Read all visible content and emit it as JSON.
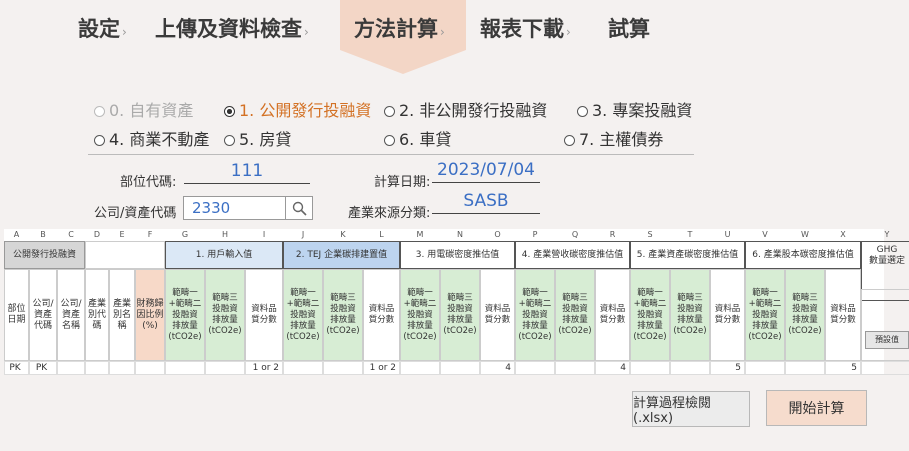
{
  "tabs": [
    {
      "label": "設定"
    },
    {
      "label": "上傳及資料檢查"
    },
    {
      "label": "方法計算"
    },
    {
      "label": "報表下載"
    },
    {
      "label": "試算"
    }
  ],
  "asset_types": [
    {
      "label": "0. 自有資產",
      "state": "disabled"
    },
    {
      "label": "1. 公開發行投融資",
      "state": "selected"
    },
    {
      "label": "2. 非公開發行投融資",
      "state": "normal"
    },
    {
      "label": "3. 專案投融資",
      "state": "normal"
    },
    {
      "label": "4. 商業不動產",
      "state": "normal"
    },
    {
      "label": "5. 房貸",
      "state": "normal"
    },
    {
      "label": "6. 車貸",
      "state": "normal"
    },
    {
      "label": "7. 主權債券",
      "state": "normal"
    }
  ],
  "form": {
    "dept_label": "部位代碼:",
    "dept_value": "111",
    "date_label": "計算日期:",
    "date_value": "2023/07/04",
    "company_label": "公司/資產代碼",
    "company_value": "2330",
    "industry_label": "產業來源分類:",
    "industry_value": "SASB"
  },
  "grid": {
    "col_letters": [
      "A",
      "B",
      "C",
      "D",
      "E",
      "F",
      "G",
      "H",
      "I",
      "J",
      "K",
      "L",
      "M",
      "N",
      "O",
      "P",
      "Q",
      "R",
      "S",
      "T",
      "U",
      "V",
      "W",
      "X",
      "Y"
    ],
    "section_label": "公開發行投融資",
    "groups": [
      "1. 用戶輸入值",
      "2. TEJ 企業碳排建置值",
      "3. 用電碳密度推估值",
      "4. 產業營收碳密度推估值",
      "5. 產業資產碳密度推估值",
      "6. 產業股本碳密度推估值"
    ],
    "ghg_header": "GHG\n數量選定",
    "base_headers": [
      "部位\n日期",
      "公司/\n資產\n代碼",
      "公司/\n資產\n名稱",
      "產業\n別代\n碼",
      "產業\n別名\n稱",
      "財務歸\n因比例\n(%)"
    ],
    "sub_headers": [
      "範疇一\n+範疇二\n投融資\n排放量\n(tCO2e)",
      "範疇三\n投融資\n排放量\n(tCO2e)",
      "資料品\n質分數"
    ],
    "default_btn": "預設值",
    "data_row": [
      "PK",
      "PK",
      "",
      "",
      "",
      "",
      "",
      "",
      "1 or 2",
      "",
      "",
      "1 or 2",
      "",
      "",
      "4",
      "",
      "",
      "4",
      "",
      "",
      "5",
      "",
      "",
      "5",
      ""
    ]
  },
  "buttons": {
    "review": "計算過程檢閱 (.xlsx)",
    "start": "開始計算"
  },
  "colors": {
    "active_tab": "#f3d6c6",
    "selected_radio": "#d37124",
    "value_text": "#3b6fc4",
    "group1_bg": "#dbe8f6",
    "group2_bg": "#bdd4ef",
    "green_bg": "#d7edd4",
    "pink_bg": "#f7d9c8",
    "gray_bg": "#d6d6d6",
    "start_btn": "#f6dccd"
  }
}
